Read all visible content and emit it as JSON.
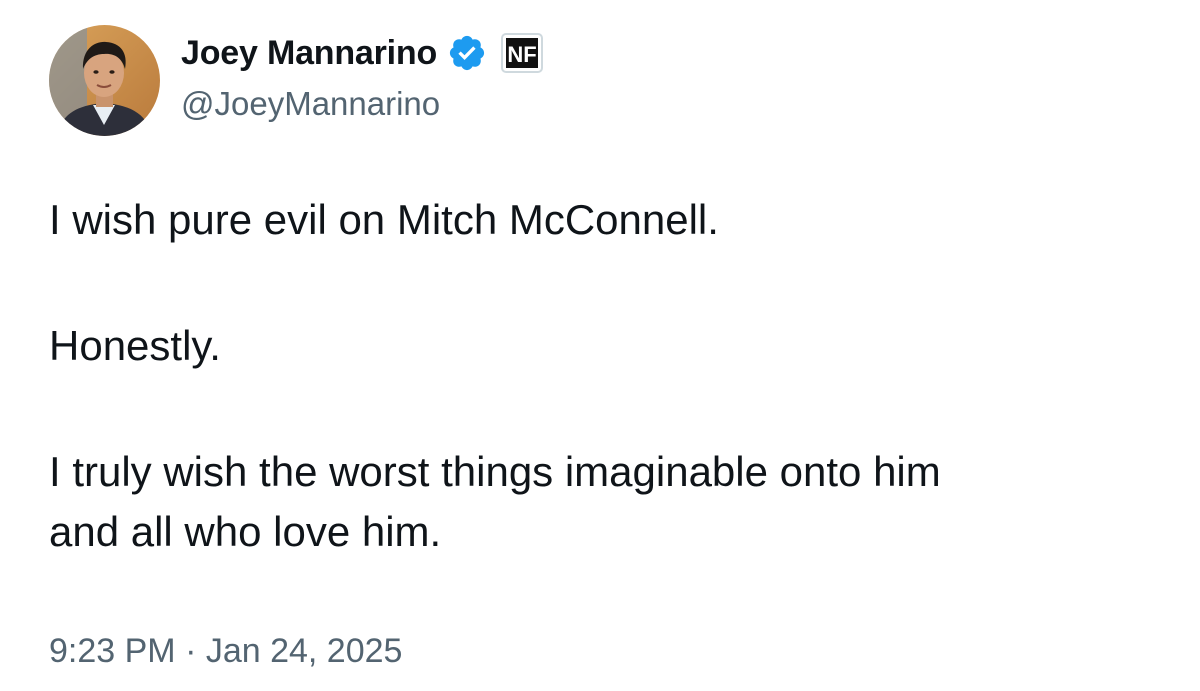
{
  "author": {
    "display_name": "Joey Mannarino",
    "handle": "@JoeyMannarino",
    "avatar_icon": "profile-photo",
    "verified_icon": "verified-badge-icon",
    "verified_color": "#1d9bf0",
    "affiliate_badge_text": "NF"
  },
  "tweet": {
    "paragraphs": [
      "I wish pure evil on Mitch McConnell.",
      "Honestly.",
      "I truly wish the worst things imaginable onto him\nand all who love him."
    ],
    "timestamp": "9:23 PM · Jan 24, 2025"
  },
  "colors": {
    "text_primary": "#0f1419",
    "text_secondary": "#536471",
    "background": "#ffffff"
  }
}
